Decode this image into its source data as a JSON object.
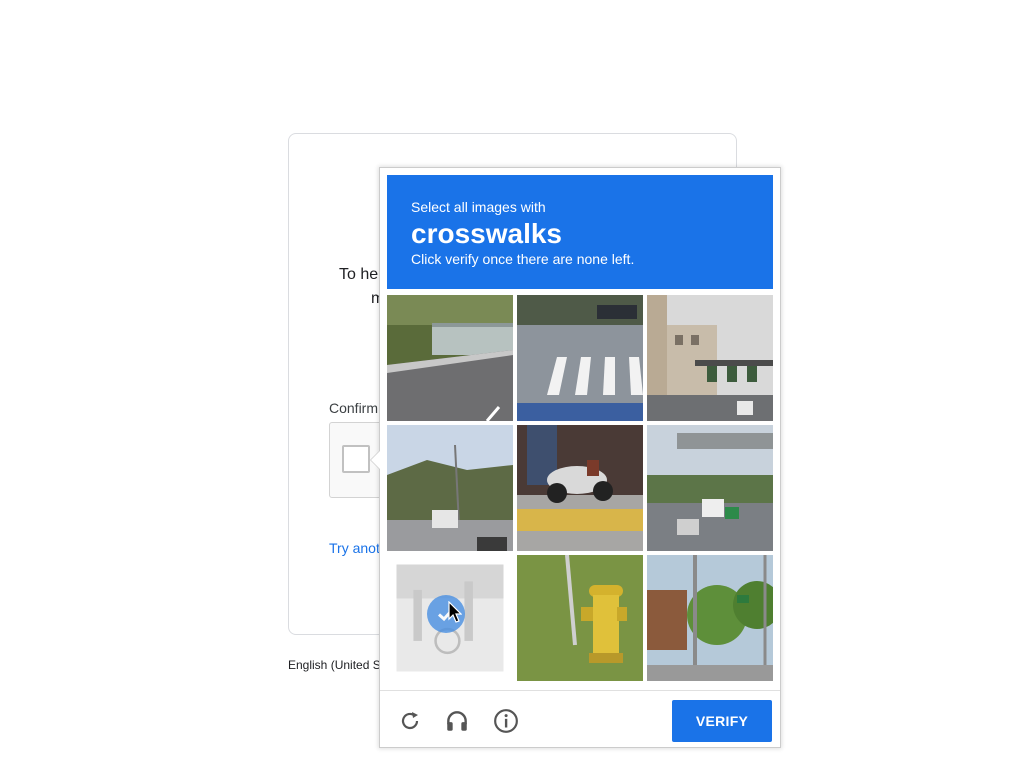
{
  "background_page": {
    "line1": "To he",
    "line2": "m",
    "confirm_label": "Confirm",
    "try_another": "Try anot",
    "language": "English (United S"
  },
  "challenge": {
    "instruction": "Select all images with",
    "target": "crosswalks",
    "note": "Click verify once there are none left.",
    "tiles": [
      {
        "label": "highway guardrail",
        "selected": false
      },
      {
        "label": "crosswalk street",
        "selected": false
      },
      {
        "label": "city buildings traffic",
        "selected": false
      },
      {
        "label": "highway hills",
        "selected": false
      },
      {
        "label": "motorcycle sidewalk",
        "selected": false
      },
      {
        "label": "highway overpass",
        "selected": false
      },
      {
        "label": "faded street",
        "selected": true
      },
      {
        "label": "fire hydrant",
        "selected": false
      },
      {
        "label": "street trees",
        "selected": false
      }
    ],
    "controls": {
      "reload_icon": "reload-icon",
      "audio_icon": "headphones-icon",
      "info_icon": "info-icon",
      "verify_label": "VERIFY"
    },
    "colors": {
      "accent": "#1a73e8"
    }
  }
}
